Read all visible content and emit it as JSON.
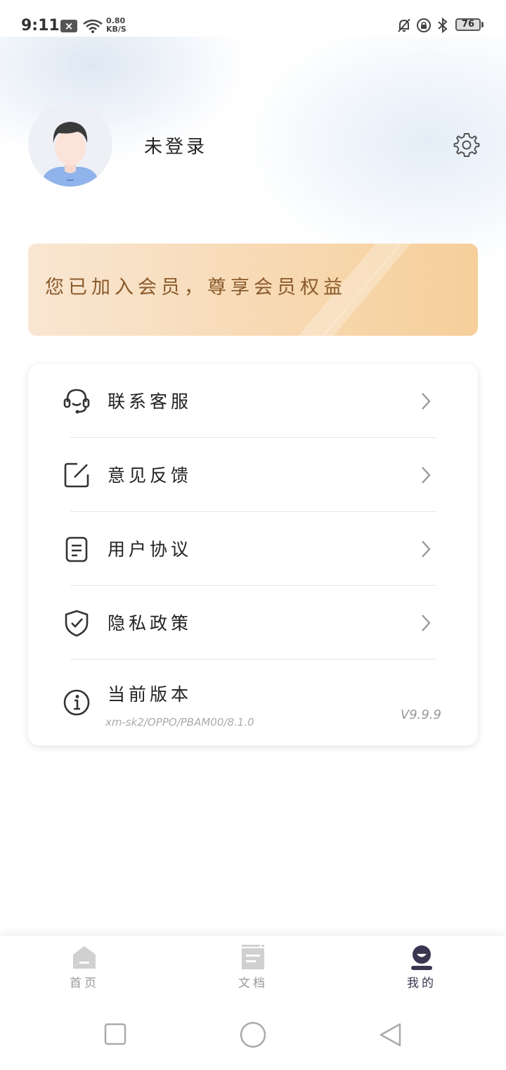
{
  "status_bar": {
    "time": "9:11",
    "notification_badge": "×",
    "net_speed_value": "0.80",
    "net_speed_unit": "KB/S",
    "battery": "76",
    "icons": [
      "wifi-icon",
      "mute-bell-icon",
      "rotation-lock-icon",
      "bluetooth-icon",
      "battery-icon"
    ]
  },
  "profile": {
    "username": "未登录",
    "avatar_icon": "user-avatar-icon",
    "settings_icon": "gear-icon"
  },
  "vip_banner": {
    "text": "您已加入会员，尊享会员权益",
    "colors": {
      "start": "#f9e6d2",
      "end": "#f6cf9a",
      "text": "#8a5a2b"
    }
  },
  "menu": {
    "items": [
      {
        "icon": "headset-icon",
        "label": "联系客服"
      },
      {
        "icon": "edit-icon",
        "label": "意见反馈"
      },
      {
        "icon": "document-icon",
        "label": "用户协议"
      },
      {
        "icon": "shield-check-icon",
        "label": "隐私政策"
      }
    ],
    "version": {
      "icon": "info-icon",
      "label": "当前版本",
      "subtitle": "xm-sk2/OPPO/PBAM00/8.1.0",
      "value": "V9.9.9"
    }
  },
  "bottom_nav": {
    "items": [
      {
        "icon": "home-icon",
        "label": "首页",
        "active": false
      },
      {
        "icon": "document-tab-icon",
        "label": "文档",
        "active": false
      },
      {
        "icon": "profile-tab-icon",
        "label": "我的",
        "active": true
      }
    ],
    "colors": {
      "active": "#3a3550",
      "inactive": "#cccccc"
    }
  },
  "system_nav": {
    "icons": [
      "square-recents-icon",
      "circle-home-icon",
      "triangle-back-icon"
    ]
  }
}
